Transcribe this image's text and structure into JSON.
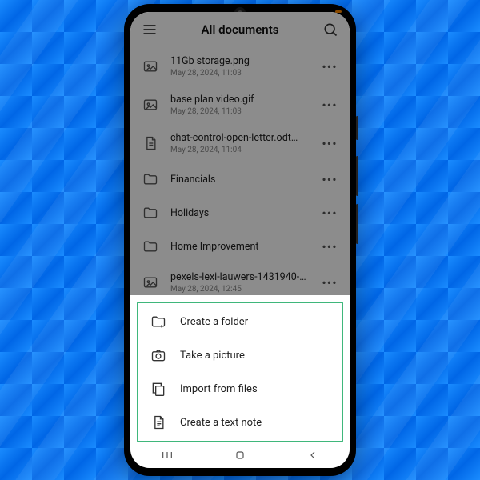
{
  "appbar": {
    "title": "All documents"
  },
  "files": [
    {
      "name": "11Gb storage.png",
      "meta": "May 28, 2024, 11:03",
      "type": "image"
    },
    {
      "name": "base plan video.gif",
      "meta": "May 28, 2024, 11:03",
      "type": "image"
    },
    {
      "name": "chat-control-open-letter.odt",
      "meta": "May 28, 2024, 11:04",
      "type": "doc",
      "badges": true
    },
    {
      "name": "Financials",
      "meta": "",
      "type": "folder"
    },
    {
      "name": "Holidays",
      "meta": "",
      "type": "folder"
    },
    {
      "name": "Home Improvement",
      "meta": "",
      "type": "folder"
    },
    {
      "name": "pexels-lexi-lauwers-1431940-1…",
      "meta": "May 28, 2024, 12:45",
      "type": "image"
    }
  ],
  "sheet": {
    "items": [
      {
        "label": "Create a folder",
        "icon": "folder-plus"
      },
      {
        "label": "Take a picture",
        "icon": "camera"
      },
      {
        "label": "Import from files",
        "icon": "copy"
      },
      {
        "label": "Create a text note",
        "icon": "note"
      }
    ]
  }
}
